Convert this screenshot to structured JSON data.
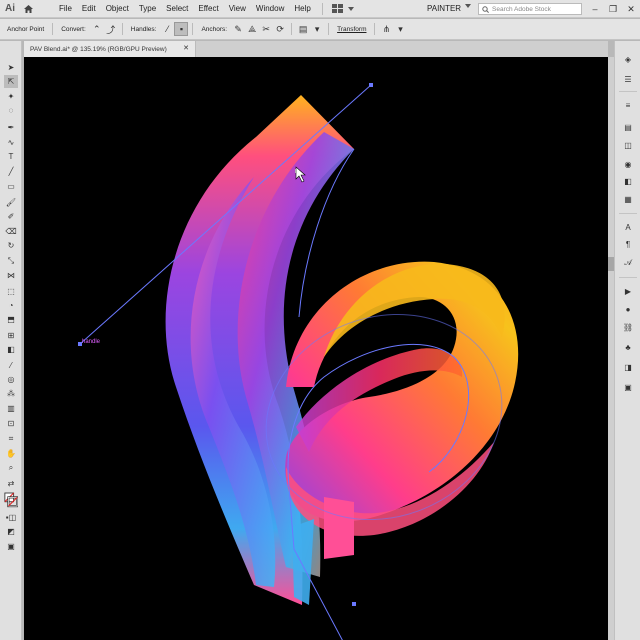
{
  "app": {
    "logo": "Ai",
    "menus": [
      "File",
      "Edit",
      "Object",
      "Type",
      "Select",
      "Effect",
      "View",
      "Window",
      "Help"
    ],
    "workspace": "PAINTER",
    "search_placeholder": "Search Adobe Stock"
  },
  "controlbar": {
    "anchor_point": "Anchor Point",
    "convert": "Convert:",
    "handles": "Handles:",
    "anchors": "Anchors:",
    "transform": "Transform"
  },
  "document": {
    "tab_title": "PAV Blend.ai* @ 135.19% (RGB/GPU Preview)",
    "handle_label": "handle"
  },
  "icons": {
    "home": "home-icon",
    "arrange": "arrange-documents-icon",
    "search": "search-icon",
    "minimize": "minimize-icon",
    "restore": "restore-icon",
    "close": "close-icon"
  },
  "colors": {
    "canvas": "#000000",
    "path_stroke": "#6b79ff",
    "gradient": [
      "#f7c21c",
      "#ff7a34",
      "#ff3d8b",
      "#b63fe0",
      "#7b4ef0",
      "#3fb0f0"
    ]
  }
}
